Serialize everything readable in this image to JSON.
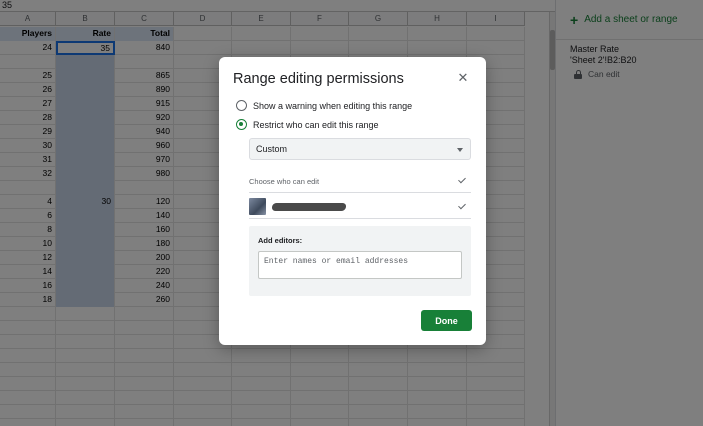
{
  "formula_bar": {
    "value": "35"
  },
  "sheet": {
    "columns": [
      "A",
      "B",
      "C",
      "D",
      "E",
      "F",
      "G",
      "H",
      "I"
    ],
    "header_row": {
      "a": "Players",
      "b": "Rate",
      "c": "Total"
    },
    "rows": [
      {
        "a": "24",
        "b": "35",
        "c": "840"
      },
      {
        "a": "",
        "b": "",
        "c": ""
      },
      {
        "a": "25",
        "b": "",
        "c": "865"
      },
      {
        "a": "26",
        "b": "",
        "c": "890"
      },
      {
        "a": "27",
        "b": "",
        "c": "915"
      },
      {
        "a": "28",
        "b": "",
        "c": "920"
      },
      {
        "a": "29",
        "b": "",
        "c": "940"
      },
      {
        "a": "30",
        "b": "",
        "c": "960"
      },
      {
        "a": "31",
        "b": "",
        "c": "970"
      },
      {
        "a": "32",
        "b": "",
        "c": "980"
      },
      {
        "a": "",
        "b": "",
        "c": ""
      },
      {
        "a": "4",
        "b": "30",
        "c": "120"
      },
      {
        "a": "6",
        "b": "",
        "c": "140"
      },
      {
        "a": "8",
        "b": "",
        "c": "160"
      },
      {
        "a": "10",
        "b": "",
        "c": "180"
      },
      {
        "a": "12",
        "b": "",
        "c": "200"
      },
      {
        "a": "14",
        "b": "",
        "c": "220"
      },
      {
        "a": "16",
        "b": "",
        "c": "240"
      },
      {
        "a": "18",
        "b": "",
        "c": "260"
      }
    ],
    "blank_rows": 10
  },
  "side_panel": {
    "add_label": "Add a sheet or range",
    "range_name": "Master Rate",
    "range_ref": "'Sheet 2'!B2:B20",
    "range_perm": "Can edit"
  },
  "dialog": {
    "title": "Range editing permissions",
    "close_icon": "close-icon",
    "option_warning": "Show a warning when editing this range",
    "option_restrict": "Restrict who can edit this range",
    "selected_option": "restrict",
    "select_value": "Custom",
    "choose_label": "Choose who can edit",
    "add_editors_label": "Add editors:",
    "add_editors_placeholder": "Enter names or email addresses",
    "done_label": "Done"
  },
  "colors": {
    "accent_green": "#188038",
    "header_fill": "#dbe6f6",
    "selection_fill": "#c9d6ea"
  }
}
